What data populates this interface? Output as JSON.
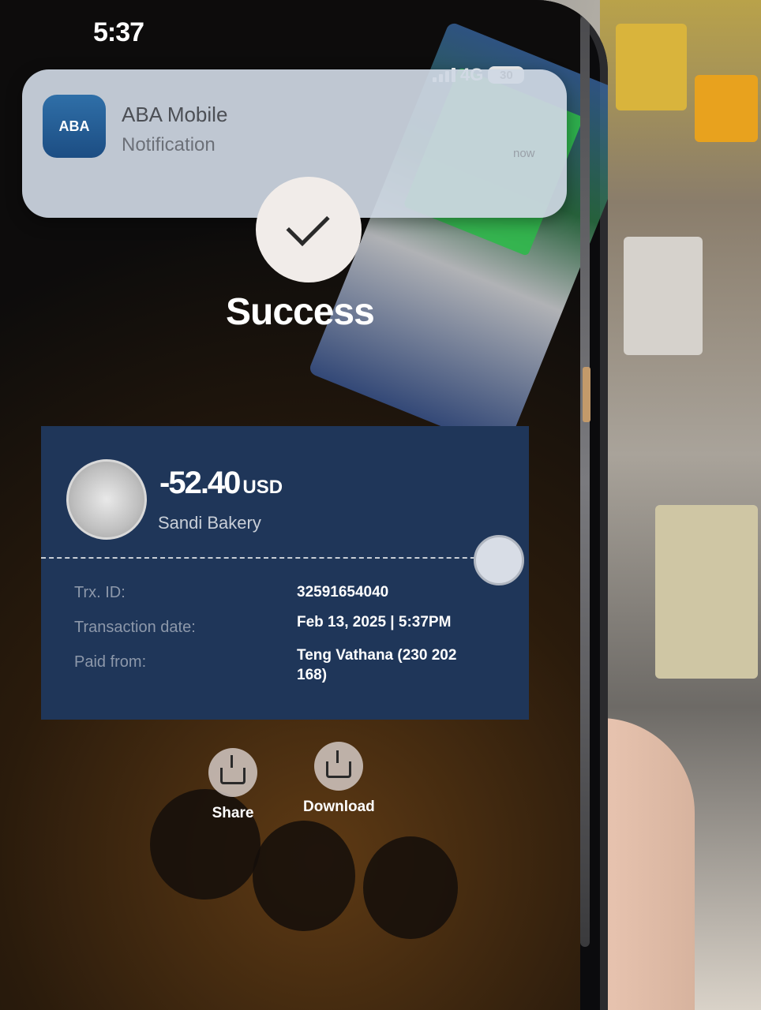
{
  "status_bar": {
    "time": "5:37",
    "network": "4G",
    "battery": "30"
  },
  "notification": {
    "app_name": "ABA Mobile",
    "body": "Notification",
    "time": "now",
    "icon_text": "ABA"
  },
  "result": {
    "title": "Success"
  },
  "transaction": {
    "amount": "-52.40",
    "currency": "USD",
    "merchant": "Sandi Bakery",
    "rows": [
      {
        "label": "Trx. ID:",
        "value": "32591654040"
      },
      {
        "label": "Transaction date:",
        "value": "Feb 13, 2025 | 5:37PM"
      },
      {
        "label": "Paid from:",
        "value": "Teng Vathana (230 202 168)"
      }
    ]
  },
  "actions": {
    "share": "Share",
    "download": "Download"
  }
}
